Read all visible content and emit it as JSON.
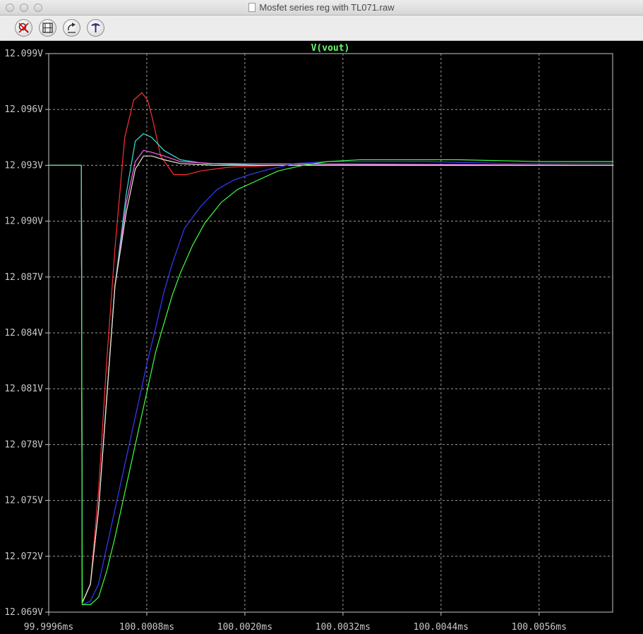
{
  "window": {
    "title": "Mosfet series reg with TL071.raw"
  },
  "toolbar": {
    "buttons": [
      {
        "name": "zoom-cancel-button",
        "icon": "zoom-cancel-icon"
      },
      {
        "name": "autorange-button",
        "icon": "autorange-icon"
      },
      {
        "name": "undo-zoom-button",
        "icon": "undo-zoom-icon"
      },
      {
        "name": "probe-button",
        "icon": "probe-icon"
      }
    ]
  },
  "chart_data": {
    "type": "line",
    "title": "V(vout)",
    "title_color": "#66ff66",
    "background": "#000000",
    "grid": true,
    "xlim": [
      99.9996,
      100.0065
    ],
    "ylim": [
      12.069,
      12.099
    ],
    "xticks": [
      99.9996,
      100.0008,
      100.002,
      100.0032,
      100.0044,
      100.0056
    ],
    "xtick_labels": [
      "99.9996ms",
      "100.0008ms",
      "100.0020ms",
      "100.0032ms",
      "100.0044ms",
      "100.0056ms"
    ],
    "yticks": [
      12.069,
      12.072,
      12.075,
      12.078,
      12.081,
      12.084,
      12.087,
      12.09,
      12.093,
      12.096,
      12.099
    ],
    "ytick_labels": [
      "12.069V",
      "12.072V",
      "12.075V",
      "12.078V",
      "12.081V",
      "12.084V",
      "12.087V",
      "12.090V",
      "12.093V",
      "12.096V",
      "12.099V"
    ],
    "series": [
      {
        "color": "#ff3030",
        "x": [
          99.9996,
          100.0,
          100.00001,
          100.00011,
          100.00021,
          100.00031,
          100.00041,
          100.00053,
          100.00064,
          100.00074,
          100.00081,
          100.00087,
          100.00097,
          100.00113,
          100.00129,
          100.00146,
          100.00181,
          100.00241,
          100.00341,
          100.00651
        ],
        "y": [
          12.093,
          12.093,
          12.0695,
          12.0705,
          12.0755,
          12.0825,
          12.0885,
          12.0945,
          12.0965,
          12.0969,
          12.0965,
          12.0955,
          12.0935,
          12.0925,
          12.0925,
          12.0927,
          12.0929,
          12.093,
          12.093,
          12.093
        ]
      },
      {
        "color": "#40e0d0",
        "x": [
          99.9996,
          100.0,
          100.00001,
          100.00011,
          100.00021,
          100.00031,
          100.00041,
          100.00055,
          100.00066,
          100.00076,
          100.00086,
          100.00101,
          100.00121,
          100.00151,
          100.00221,
          100.00651
        ],
        "y": [
          12.093,
          12.093,
          12.0695,
          12.0705,
          12.0745,
          12.0805,
          12.0865,
          12.0915,
          12.0943,
          12.0947,
          12.0945,
          12.0938,
          12.0933,
          12.0931,
          12.093,
          12.093
        ]
      },
      {
        "color": "#ff66ff",
        "x": [
          99.9996,
          100.0,
          100.00001,
          100.00011,
          100.00021,
          100.00031,
          100.00041,
          100.00055,
          100.00066,
          100.00076,
          100.00086,
          100.00101,
          100.00121,
          100.00161,
          100.00651
        ],
        "y": [
          12.093,
          12.093,
          12.0695,
          12.0705,
          12.0745,
          12.0805,
          12.0865,
          12.091,
          12.0932,
          12.0938,
          12.0937,
          12.0935,
          12.0932,
          12.0931,
          12.093
        ]
      },
      {
        "color": "#e8e8c8",
        "x": [
          99.9996,
          100.0,
          100.00001,
          100.00011,
          100.00021,
          100.00031,
          100.00041,
          100.00055,
          100.00066,
          100.00076,
          100.00086,
          100.00101,
          100.00121,
          100.00161,
          100.00651
        ],
        "y": [
          12.093,
          12.093,
          12.0695,
          12.0705,
          12.0745,
          12.0805,
          12.0865,
          12.0905,
          12.0928,
          12.0935,
          12.0935,
          12.0933,
          12.0931,
          12.093,
          12.093
        ]
      },
      {
        "color": "#3a3aff",
        "x": [
          99.9996,
          100.0,
          100.00001,
          100.00011,
          100.00021,
          100.00031,
          100.00041,
          100.00051,
          100.00061,
          100.00071,
          100.00081,
          100.00091,
          100.00101,
          100.00111,
          100.00126,
          100.00146,
          100.00166,
          100.00186,
          100.00206,
          100.00231,
          100.00261,
          100.00301,
          100.00351,
          100.00421,
          100.00521,
          100.00651
        ],
        "y": [
          12.093,
          12.093,
          12.0694,
          12.0696,
          12.0705,
          12.0725,
          12.0745,
          12.0765,
          12.0785,
          12.0805,
          12.0825,
          12.0843,
          12.0862,
          12.0877,
          12.0896,
          12.0908,
          12.0917,
          12.0922,
          12.0925,
          12.0928,
          12.0931,
          12.0932,
          12.0932,
          12.0932,
          12.0931,
          12.0931
        ]
      },
      {
        "color": "#40ff40",
        "x": [
          99.9996,
          100.0,
          100.00001,
          100.00011,
          100.00021,
          100.00031,
          100.00041,
          100.00051,
          100.00061,
          100.00071,
          100.00081,
          100.00091,
          100.00101,
          100.00111,
          100.00121,
          100.00136,
          100.00151,
          100.00171,
          100.00191,
          100.00216,
          100.00241,
          100.00271,
          100.00301,
          100.00341,
          100.00391,
          100.00461,
          100.00561,
          100.00651
        ],
        "y": [
          12.093,
          12.093,
          12.0694,
          12.0694,
          12.0698,
          12.0712,
          12.073,
          12.075,
          12.077,
          12.079,
          12.081,
          12.083,
          12.0845,
          12.086,
          12.0872,
          12.0887,
          12.0899,
          12.091,
          12.0917,
          12.0922,
          12.0927,
          12.093,
          12.0932,
          12.0933,
          12.0933,
          12.0933,
          12.0932,
          12.0932
        ]
      }
    ]
  }
}
